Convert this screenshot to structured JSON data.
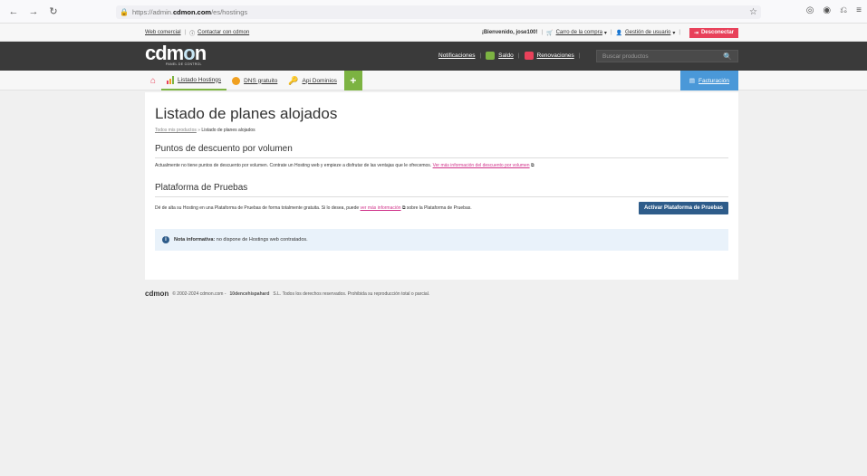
{
  "browser": {
    "url_pre": "https://admin.",
    "url_domain": "cdmon.com",
    "url_post": "/es/hostings"
  },
  "util": {
    "web_comercial": "Web comercial",
    "contactar": "Contactar con cdmon",
    "bienvenido": "¡Bienvenido, jose100!",
    "carro": "Carro de la compra",
    "gestion": "Gestión de usuario",
    "desconectar": "Desconectar"
  },
  "header": {
    "logo": "cdm",
    "logo_o": "o",
    "logo_n": "n",
    "logo_sub": "PANEL DE CONTROL",
    "notificaciones": "Notificaciones",
    "saldo_badge": "0€",
    "saldo": "Saldo",
    "renov_badge": "0",
    "renovaciones": "Renovaciones",
    "search_placeholder": "Buscar productos"
  },
  "menu": {
    "hostings": "Listado Hostings",
    "dns": "DNS gratuito",
    "api": "Api Dominios",
    "plus": "+",
    "facturacion": "Facturación"
  },
  "main": {
    "title": "Listado de planes alojados",
    "crumb_link": "Todos mis productos",
    "crumb_sep": "»",
    "crumb_current": "Listado de planes alojados",
    "sec1_title": "Puntos de descuento por volumen",
    "sec1_text": "Actualmente no tiene puntos de descuento por volumen. Contrate un Hosting web y empieze a disfrutar de las ventajas que le ofrecemos.",
    "sec1_link": "Ver más información del descuento por volumen",
    "sec2_title": "Plataforma de Pruebas",
    "sec2_text_a": "Dé de alta su Hosting en una Plataforma de Pruebas de forma totalmente gratuita. Si lo desea, puede",
    "sec2_link": "ver más información",
    "sec2_text_b": "sobre la Plataforma de Pruebas.",
    "activar_btn": "Activar Plataforma de Pruebas",
    "nota_label": "Nota informativa:",
    "nota_text": "no dispone de Hostings web contratados."
  },
  "footer": {
    "logo": "cdmon",
    "copy_a": "© 2002-2024 cdmon.com -",
    "copy_b": "10dencehispahard",
    "copy_c": "S.L. Todos los derechos reservados. Prohibida su reproducción total o parcial."
  },
  "colors": {
    "accent_pink": "#e8415a",
    "accent_green": "#7cb342",
    "accent_blue": "#4a98d8",
    "button_blue": "#2e5c8a"
  }
}
